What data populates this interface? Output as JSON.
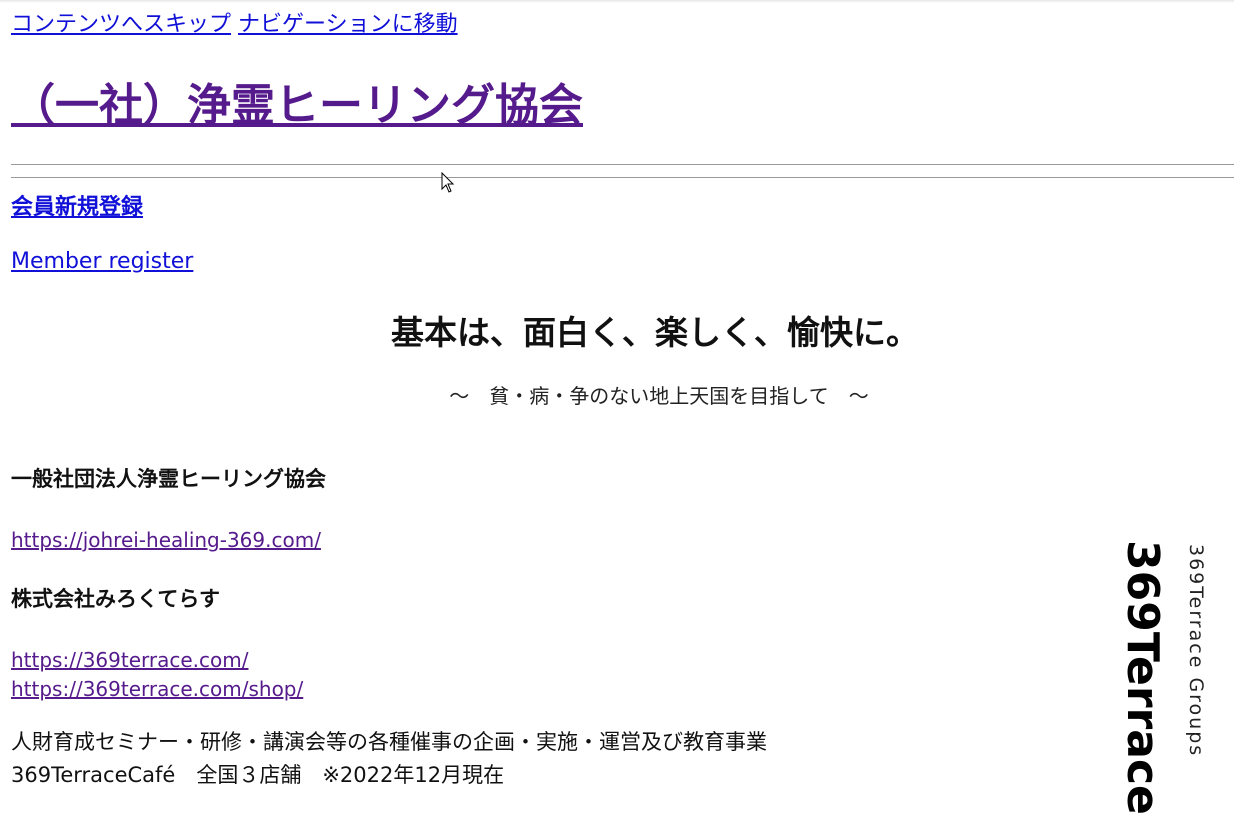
{
  "skip_links": {
    "to_content": "コンテンツへスキップ",
    "to_navigation": "ナビゲーションに移動"
  },
  "site": {
    "title": "（一社）浄霊ヒーリング協会"
  },
  "member": {
    "new_registration": "会員新規登録",
    "register": "Member register"
  },
  "hero": {
    "headline": "基本は、面白く、楽しく、愉快に。",
    "subline": "〜　貧・病・争のない地上天国を目指して　〜"
  },
  "orgs": {
    "association_name": "一般社団法人浄霊ヒーリング協会",
    "association_url": "https://johrei-healing-369.com/",
    "company_name": "株式会社みろくてらす",
    "company_url": "https://369terrace.com/",
    "company_shop_url": "https://369terrace.com/shop/"
  },
  "description": {
    "line1": "人財育成セミナー・研修・講演会等の各種催事の企画・実施・運営及び教育事業",
    "line2": "369TerraceCafé　全国３店舗　※2022年12月現在"
  },
  "brand": {
    "name": "369Terrace",
    "groups": "369Terrace Groups"
  },
  "colors": {
    "link": "#1010d8",
    "visited_link": "#551a8b",
    "text": "#111111"
  }
}
